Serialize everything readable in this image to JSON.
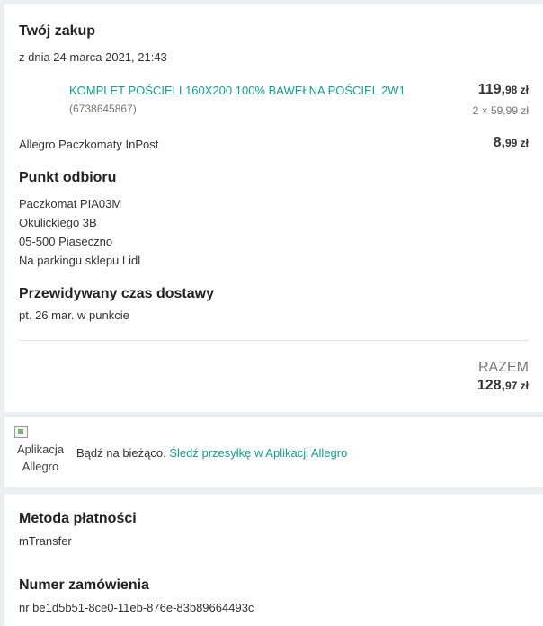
{
  "order": {
    "title": "Twój zakup",
    "date": "z dnia 24 marca 2021, 21:43",
    "item": {
      "name": "KOMPLET POŚCIELI 160X200 100% BAWEŁNA POŚCIEL 2W1",
      "id": "(6738645867)",
      "price_main": "119,",
      "price_cents": "98 zł",
      "qty_price": "2 × 59,99 zł"
    },
    "shipping": {
      "label": "Allegro Paczkomaty InPost",
      "price_main": "8,",
      "price_cents": "99 zł"
    },
    "pickup": {
      "title": "Punkt odbioru",
      "lines": [
        "Paczkomat PIA03M",
        "Okulickiego 3B",
        "05-500 Piaseczno",
        "Na parkingu sklepu Lidl"
      ]
    },
    "delivery": {
      "title": "Przewidywany czas dostawy",
      "value": "pt. 26 mar. w punkcie"
    },
    "total": {
      "label": "RAZEM",
      "price_main": "128,",
      "price_cents": "97 zł"
    }
  },
  "app_banner": {
    "image_alt_line1": "Aplikacja",
    "image_alt_line2": "Allegro",
    "text": "Bądź na bieżąco.",
    "link": "Śledź przesyłkę w Aplikacji Allegro"
  },
  "payment": {
    "title": "Metoda płatności",
    "value": "mTransfer"
  },
  "order_number": {
    "title": "Numer zamówienia",
    "value": "nr be1d5b51-8ce0-11eb-876e-83b89664493c"
  },
  "colors": {
    "link": "#169e8f",
    "background": "#eceff1"
  },
  "icons": {
    "broken_image": "image-placeholder-icon"
  }
}
